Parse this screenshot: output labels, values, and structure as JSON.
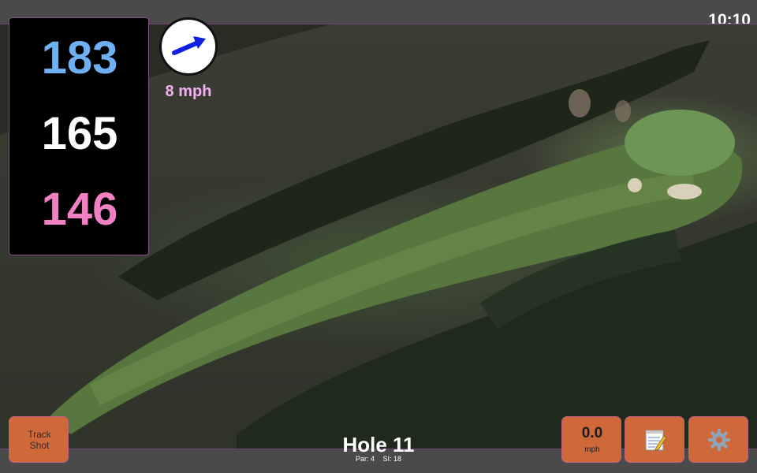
{
  "status_bar": {
    "time": "10:10"
  },
  "distances": {
    "back": "183",
    "middle": "165",
    "front": "146"
  },
  "wind": {
    "speed": "8 mph",
    "direction_icon": "arrow-up-right-icon"
  },
  "map": {
    "view": "satellite",
    "subject": "golf hole fairway and green"
  },
  "hole": {
    "title": "Hole 11",
    "par": "Par: 4",
    "stroke_index": "SI: 18"
  },
  "buttons": {
    "track_shot": "Track\nShot",
    "speed_value": "0.0",
    "speed_unit": "mph",
    "notes_icon": "notepad-icon",
    "settings_icon": "gear-icon"
  },
  "colors": {
    "back_distance": "#6fb0f2",
    "middle_distance": "#ffffff",
    "front_distance": "#f07fc4",
    "wind_text": "#f3b0f0",
    "button_bg": "#d0693a",
    "frame_accent": "#8a4b92"
  }
}
